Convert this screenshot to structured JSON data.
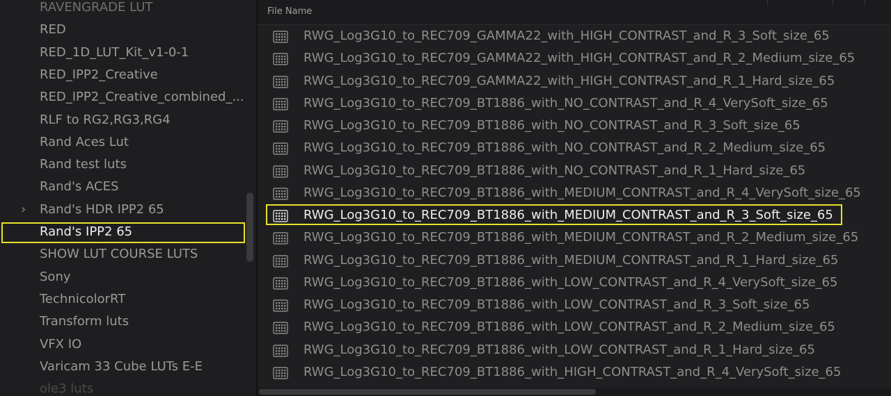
{
  "folder_tree": {
    "items": [
      {
        "label": "RAVENGRADE LUT",
        "state": "faded"
      },
      {
        "label": "RED",
        "state": "normal"
      },
      {
        "label": "RED_1D_LUT_Kit_v1-0-1",
        "state": "normal"
      },
      {
        "label": "RED_IPP2_Creative",
        "state": "normal"
      },
      {
        "label": "RED_IPP2_Creative_combined_...",
        "state": "normal"
      },
      {
        "label": "RLF to RG2,RG3,RG4",
        "state": "normal"
      },
      {
        "label": "Rand Aces Lut",
        "state": "normal"
      },
      {
        "label": "Rand test luts",
        "state": "normal"
      },
      {
        "label": "Rand's ACES",
        "state": "normal"
      },
      {
        "label": "Rand's HDR IPP2 65",
        "state": "normal",
        "expandable": true,
        "chevron": "›"
      },
      {
        "label": "Rand's IPP2 65",
        "state": "selected"
      },
      {
        "label": "SHOW LUT COURSE LUTS",
        "state": "normal"
      },
      {
        "label": "Sony",
        "state": "normal"
      },
      {
        "label": "TechnicolorRT",
        "state": "normal"
      },
      {
        "label": "Transform luts",
        "state": "normal"
      },
      {
        "label": "VFX IO",
        "state": "normal"
      },
      {
        "label": "Varicam 33 Cube LUTs E-E",
        "state": "normal"
      },
      {
        "label": "ole3 luts",
        "state": "faded-more"
      }
    ]
  },
  "file_list": {
    "header": "File Name",
    "icon": "lut-grid-icon",
    "files": [
      {
        "name": "RWG_Log3G10_to_REC709_GAMMA22_with_HIGH_CONTRAST_and_R_3_Soft_size_65",
        "selected": false
      },
      {
        "name": "RWG_Log3G10_to_REC709_GAMMA22_with_HIGH_CONTRAST_and_R_2_Medium_size_65",
        "selected": false
      },
      {
        "name": "RWG_Log3G10_to_REC709_GAMMA22_with_HIGH_CONTRAST_and_R_1_Hard_size_65",
        "selected": false
      },
      {
        "name": "RWG_Log3G10_to_REC709_BT1886_with_NO_CONTRAST_and_R_4_VerySoft_size_65",
        "selected": false
      },
      {
        "name": "RWG_Log3G10_to_REC709_BT1886_with_NO_CONTRAST_and_R_3_Soft_size_65",
        "selected": false
      },
      {
        "name": "RWG_Log3G10_to_REC709_BT1886_with_NO_CONTRAST_and_R_2_Medium_size_65",
        "selected": false
      },
      {
        "name": "RWG_Log3G10_to_REC709_BT1886_with_NO_CONTRAST_and_R_1_Hard_size_65",
        "selected": false
      },
      {
        "name": "RWG_Log3G10_to_REC709_BT1886_with_MEDIUM_CONTRAST_and_R_4_VerySoft_size_65",
        "selected": false
      },
      {
        "name": "RWG_Log3G10_to_REC709_BT1886_with_MEDIUM_CONTRAST_and_R_3_Soft_size_65",
        "selected": true
      },
      {
        "name": "RWG_Log3G10_to_REC709_BT1886_with_MEDIUM_CONTRAST_and_R_2_Medium_size_65",
        "selected": false
      },
      {
        "name": "RWG_Log3G10_to_REC709_BT1886_with_MEDIUM_CONTRAST_and_R_1_Hard_size_65",
        "selected": false
      },
      {
        "name": "RWG_Log3G10_to_REC709_BT1886_with_LOW_CONTRAST_and_R_4_VerySoft_size_65",
        "selected": false
      },
      {
        "name": "RWG_Log3G10_to_REC709_BT1886_with_LOW_CONTRAST_and_R_3_Soft_size_65",
        "selected": false
      },
      {
        "name": "RWG_Log3G10_to_REC709_BT1886_with_LOW_CONTRAST_and_R_2_Medium_size_65",
        "selected": false
      },
      {
        "name": "RWG_Log3G10_to_REC709_BT1886_with_LOW_CONTRAST_and_R_1_Hard_size_65",
        "selected": false
      },
      {
        "name": "RWG_Log3G10_to_REC709_BT1886_with_HIGH_CONTRAST_and_R_4_VerySoft_size_65",
        "selected": false
      }
    ]
  },
  "colors": {
    "highlight": "#e8e22a",
    "background": "#1f1f21",
    "text": "#8e8e8e",
    "text_selected": "#eeeeee"
  }
}
